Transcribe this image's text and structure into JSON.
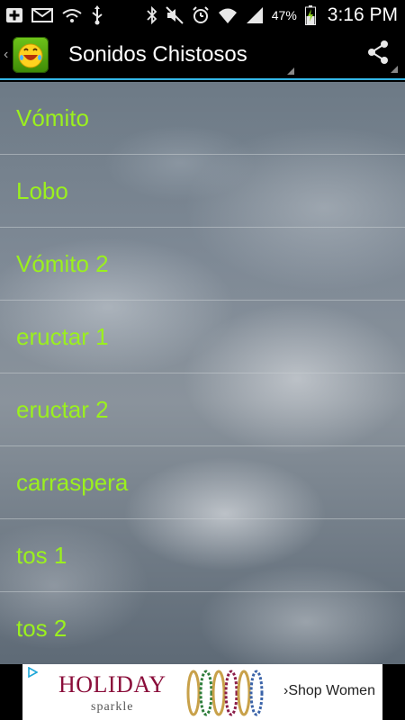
{
  "status_bar": {
    "battery_percent": "47%",
    "time": "3:16 PM",
    "left_icons": [
      "add-notification-icon",
      "mail-icon",
      "wifi-notification-icon",
      "usb-icon"
    ],
    "right_icons": [
      "bluetooth-icon",
      "mute-icon",
      "alarm-icon",
      "wifi-icon",
      "signal-icon",
      "battery-charging-icon"
    ]
  },
  "action_bar": {
    "title": "Sonidos Chistosos",
    "up_icon": "chevron-left-icon",
    "app_icon": "smiley-app-icon",
    "share_icon": "share-icon"
  },
  "list": {
    "items": [
      {
        "label": "Vómito"
      },
      {
        "label": "Lobo"
      },
      {
        "label": "Vómito 2"
      },
      {
        "label": "eructar 1"
      },
      {
        "label": "eructar 2"
      },
      {
        "label": "carraspera"
      },
      {
        "label": "tos 1"
      },
      {
        "label": "tos 2"
      }
    ],
    "text_color": "#9bf01e"
  },
  "ad": {
    "headline": "HOLIDAY",
    "subline": "sparkle",
    "cta": "›Shop Women",
    "headline_color": "#8a0d3a",
    "choice_icon": "adchoices-icon"
  },
  "colors": {
    "accent": "#33b5e5"
  }
}
